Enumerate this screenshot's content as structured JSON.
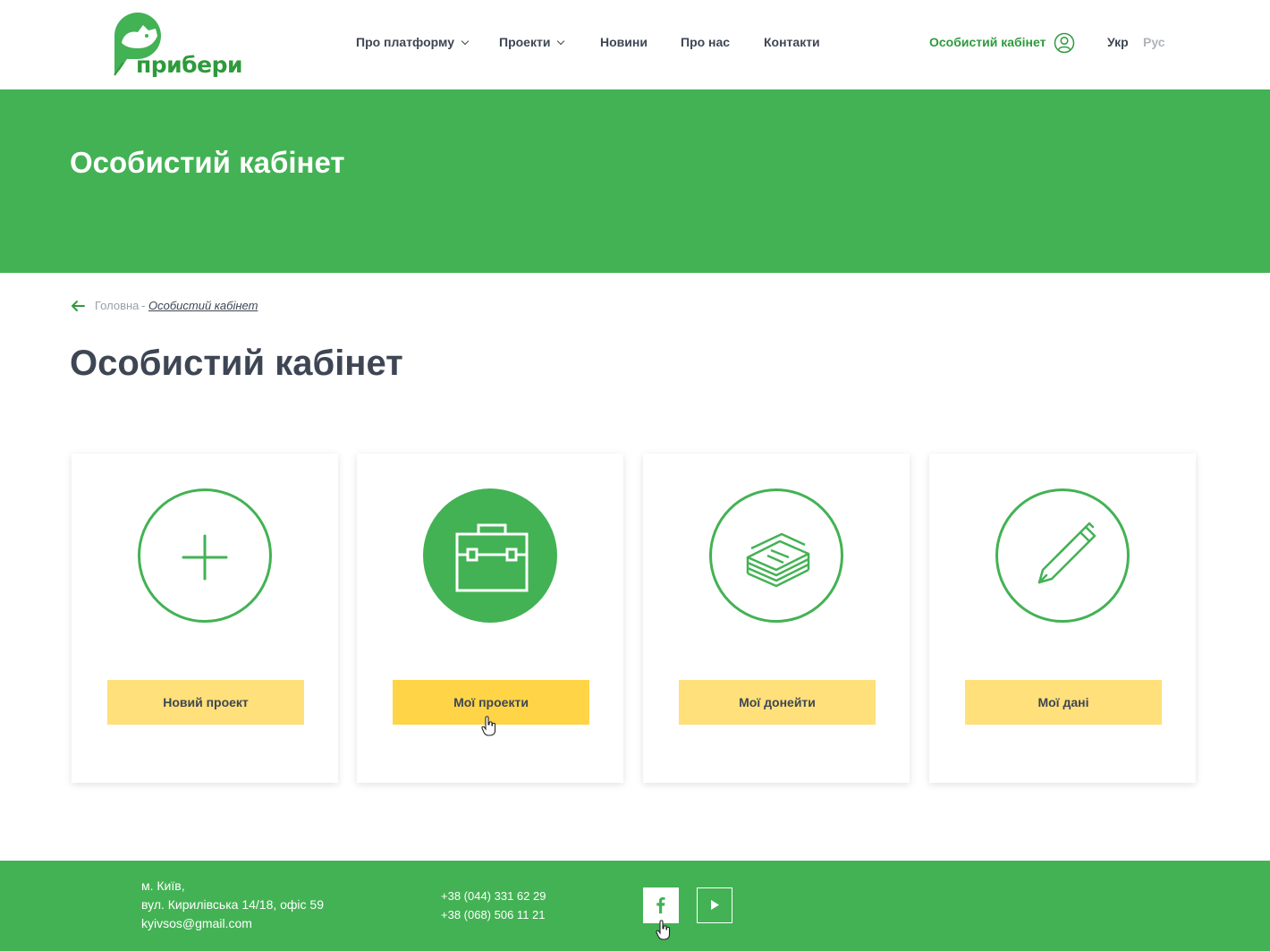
{
  "header": {
    "logo_text": "прибери",
    "nav": [
      {
        "label": "Про платформу",
        "has_dropdown": true
      },
      {
        "label": "Проекти",
        "has_dropdown": true
      },
      {
        "label": "Новини",
        "has_dropdown": false
      },
      {
        "label": "Про нас",
        "has_dropdown": false
      },
      {
        "label": "Контакти",
        "has_dropdown": false
      }
    ],
    "account_label": "Особистий кабінет",
    "account_icon": "user-icon",
    "languages": {
      "active": "Укр",
      "inactive": "Рус"
    }
  },
  "hero": {
    "title": "Особистий кабінет"
  },
  "breadcrumb": {
    "home": "Головна",
    "separator": "-",
    "current": "Особистий кабінет"
  },
  "page": {
    "title": "Особистий кабінет"
  },
  "cards": [
    {
      "icon": "plus-icon",
      "button": "Новий проект",
      "icon_filled": false
    },
    {
      "icon": "briefcase-icon",
      "button": "Мої проекти",
      "icon_filled": true
    },
    {
      "icon": "money-stack-icon",
      "button": "Мої донейти",
      "icon_filled": false
    },
    {
      "icon": "pen-icon",
      "button": "Мої дані",
      "icon_filled": false
    }
  ],
  "footer": {
    "address_city": "м. Київ,",
    "address_street": "вул. Кирилівська 14/18, офіс 59",
    "email": "kyivsos@gmail.com",
    "phone_1": "+38 (044) 331 62 29",
    "phone_2": "+38 (068) 506 11 21",
    "social": [
      "facebook-icon",
      "youtube-icon"
    ]
  },
  "colors": {
    "brand_green": "#43b254",
    "button_yellow": "#ffe07a",
    "button_yellow_hover": "#ffd447",
    "text_dark": "#3e4654"
  }
}
